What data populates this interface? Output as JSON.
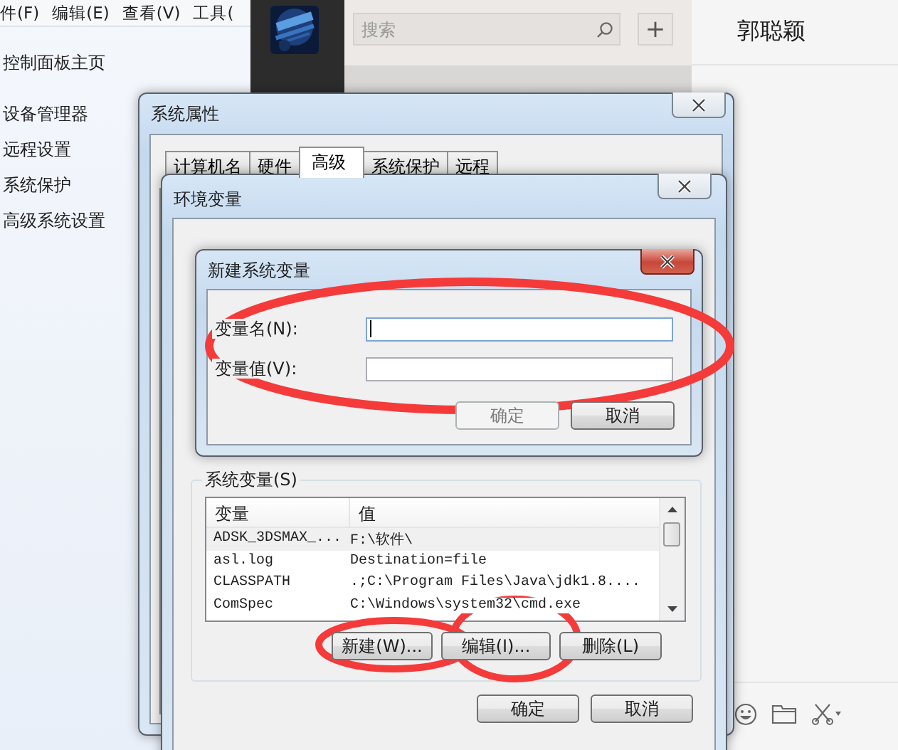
{
  "control_panel": {
    "menu": [
      "件(F)",
      "编辑(E)",
      "查看(V)",
      "工具("
    ],
    "links": [
      "控制面板主页",
      "设备管理器",
      "远程设置",
      "系统保护",
      "高级系统设置"
    ]
  },
  "chat": {
    "search": {
      "placeholder": "搜索"
    },
    "add_button": "+",
    "contact_title": "郭聪颖"
  },
  "system_properties": {
    "title": "系统属性",
    "tabs": [
      {
        "label": "计算机名",
        "selected": false
      },
      {
        "label": "硬件",
        "selected": false
      },
      {
        "label": "高级",
        "selected": true
      },
      {
        "label": "系统保护",
        "selected": false
      },
      {
        "label": "远程",
        "selected": false
      }
    ]
  },
  "environment_variables": {
    "title": "环境变量",
    "system_group": {
      "title": "系统变量(S)",
      "columns": [
        "变量",
        "值"
      ],
      "rows": [
        {
          "name": "ADSK_3DSMAX_...",
          "value": "F:\\软件\\",
          "selected": true
        },
        {
          "name": "asl.log",
          "value": "Destination=file",
          "selected": false
        },
        {
          "name": "CLASSPATH",
          "value": ".;C:\\Program Files\\Java\\jdk1.8....",
          "selected": false
        },
        {
          "name": "ComSpec",
          "value": "C:\\Windows\\system32\\cmd.exe",
          "selected": false
        }
      ],
      "buttons": [
        "新建(W)...",
        "编辑(I)...",
        "删除(L)"
      ]
    },
    "footer_buttons": [
      "确定",
      "取消"
    ]
  },
  "new_variable_dialog": {
    "title": "新建系统变量",
    "fields": [
      {
        "label": "变量名(N):",
        "focused": true
      },
      {
        "label": "变量值(V):",
        "focused": false
      }
    ],
    "buttons": [
      {
        "label": "确定",
        "disabled": true
      },
      {
        "label": "取消",
        "disabled": false
      }
    ]
  }
}
